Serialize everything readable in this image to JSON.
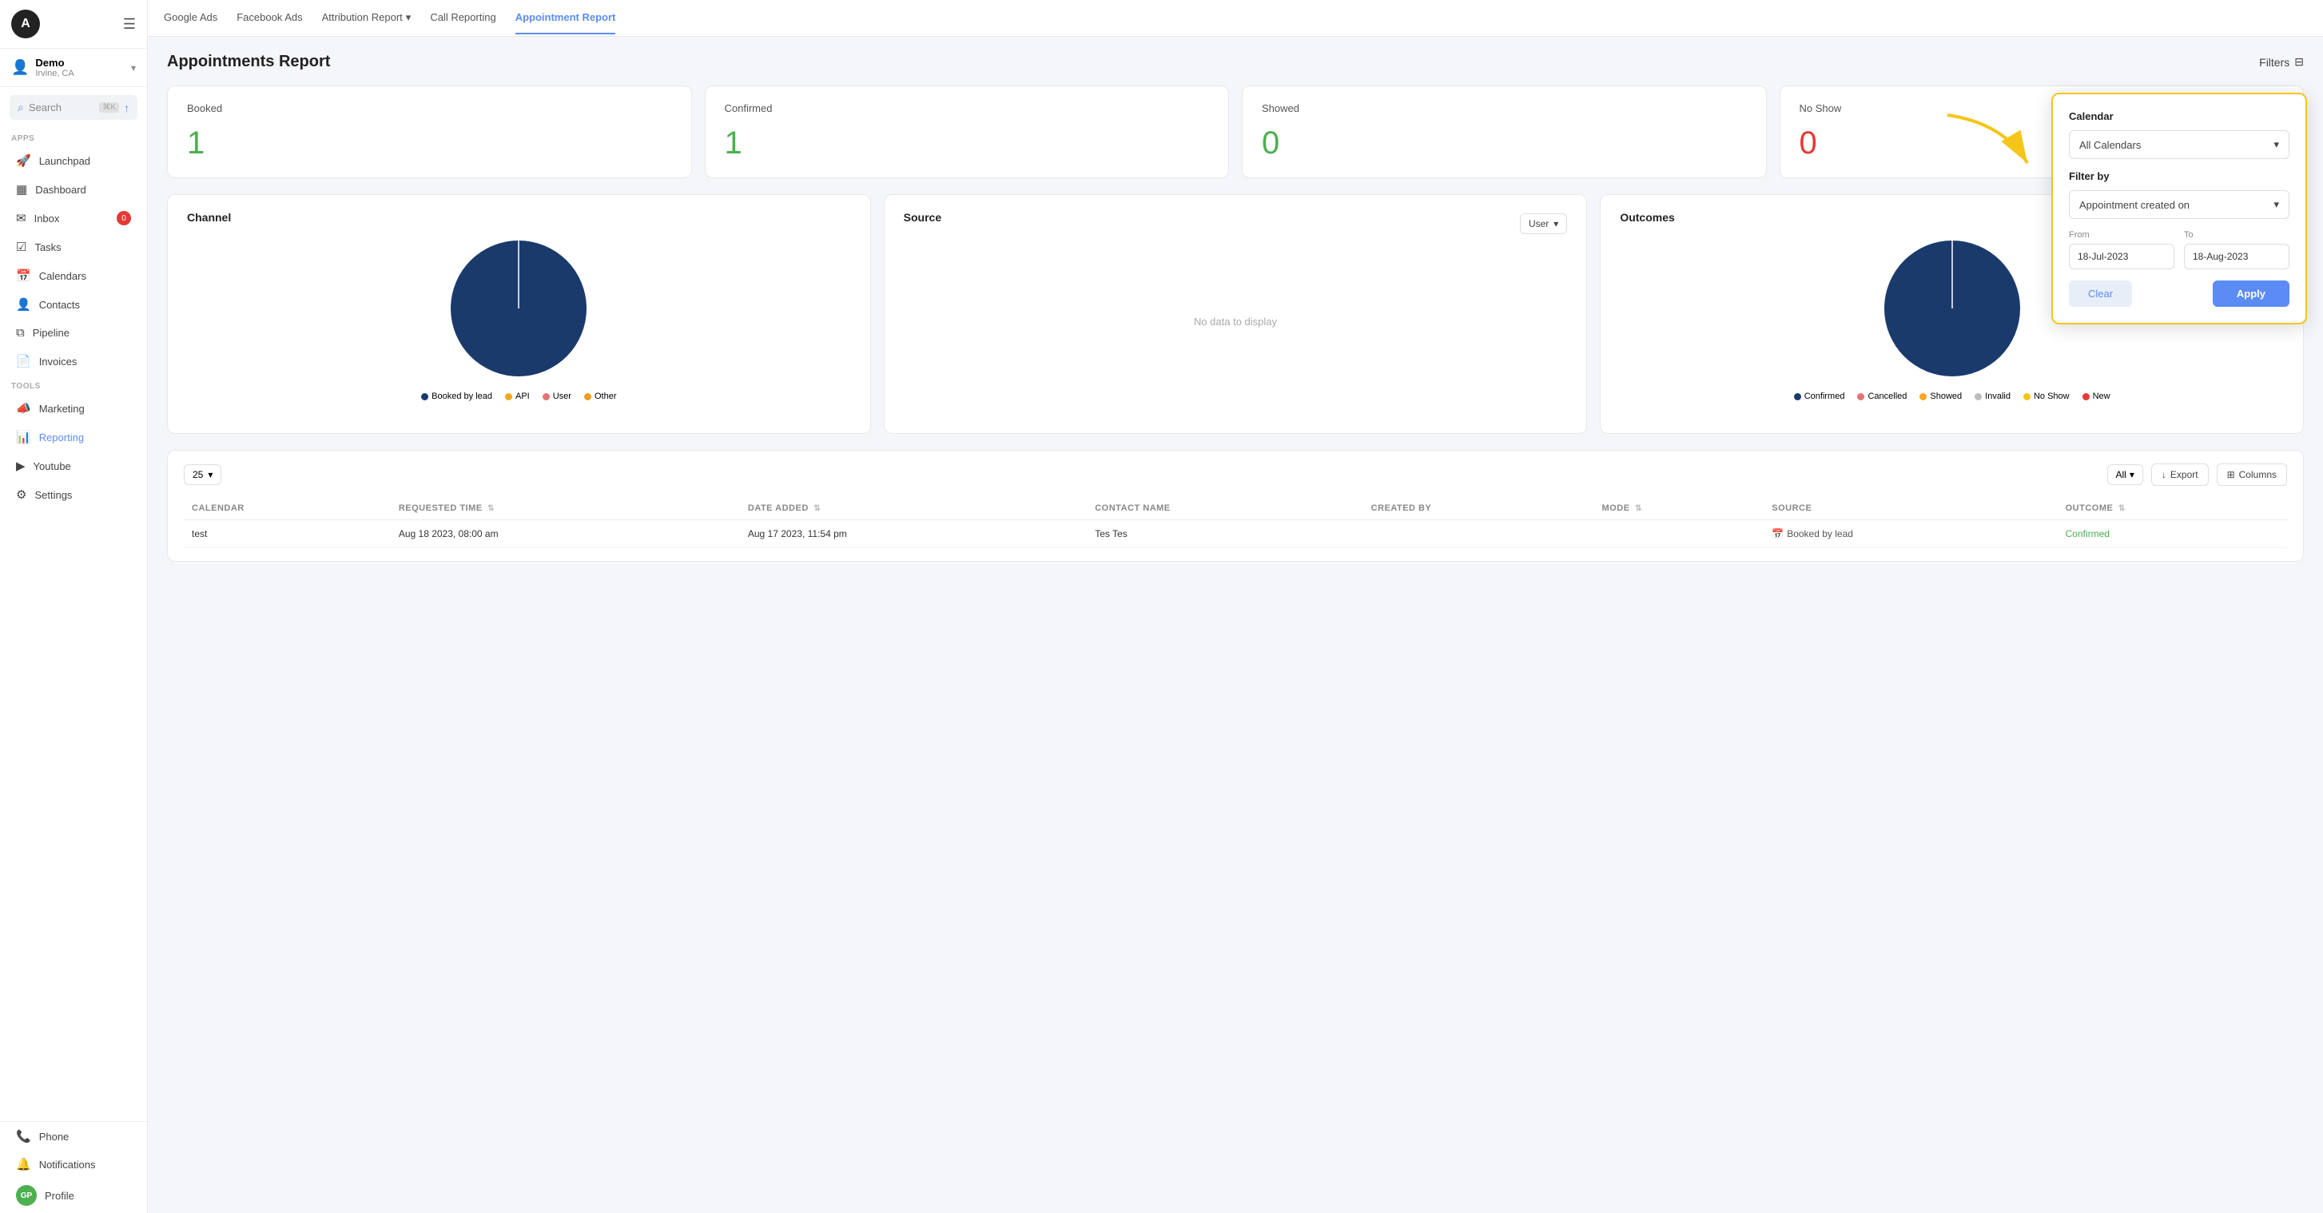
{
  "sidebar": {
    "logo_letter": "A",
    "account": {
      "name": "Demo",
      "location": "Irvine, CA"
    },
    "search": {
      "label": "Search",
      "shortcut": "⌘K"
    },
    "apps_label": "Apps",
    "apps": [
      {
        "id": "launchpad",
        "label": "Launchpad",
        "icon": "🚀"
      },
      {
        "id": "dashboard",
        "label": "Dashboard",
        "icon": "▦"
      },
      {
        "id": "inbox",
        "label": "Inbox",
        "icon": "✉",
        "badge": "0"
      },
      {
        "id": "tasks",
        "label": "Tasks",
        "icon": "☑"
      },
      {
        "id": "calendars",
        "label": "Calendars",
        "icon": "📅"
      },
      {
        "id": "contacts",
        "label": "Contacts",
        "icon": "👤"
      },
      {
        "id": "pipeline",
        "label": "Pipeline",
        "icon": "⧉"
      },
      {
        "id": "invoices",
        "label": "Invoices",
        "icon": "📄"
      }
    ],
    "tools_label": "Tools",
    "tools": [
      {
        "id": "marketing",
        "label": "Marketing",
        "icon": "📣"
      },
      {
        "id": "reporting",
        "label": "Reporting",
        "icon": "📊",
        "active": true
      },
      {
        "id": "youtube",
        "label": "Youtube",
        "icon": "▶"
      },
      {
        "id": "settings",
        "label": "Settings",
        "icon": "⚙"
      }
    ],
    "bottom": [
      {
        "id": "phone",
        "label": "Phone",
        "icon": "📞"
      },
      {
        "id": "notifications",
        "label": "Notifications",
        "icon": "🔔"
      },
      {
        "id": "profile",
        "label": "Profile",
        "icon": "GP",
        "avatar": true
      }
    ]
  },
  "topnav": {
    "items": [
      {
        "id": "google-ads",
        "label": "Google Ads",
        "active": false
      },
      {
        "id": "facebook-ads",
        "label": "Facebook Ads",
        "active": false
      },
      {
        "id": "attribution-report",
        "label": "Attribution Report",
        "active": false,
        "has_arrow": true
      },
      {
        "id": "call-reporting",
        "label": "Call Reporting",
        "active": false
      },
      {
        "id": "appointment-report",
        "label": "Appointment Report",
        "active": true
      }
    ]
  },
  "page": {
    "title": "Appointments Report",
    "filters_label": "Filters"
  },
  "stats": [
    {
      "id": "booked",
      "label": "Booked",
      "value": "1",
      "color": "green"
    },
    {
      "id": "confirmed",
      "label": "Confirmed",
      "value": "1",
      "color": "green"
    },
    {
      "id": "showed",
      "label": "Showed",
      "value": "0",
      "color": "green"
    },
    {
      "id": "no-show",
      "label": "No Show",
      "value": "0",
      "color": "red"
    }
  ],
  "charts": {
    "channel": {
      "title": "Channel",
      "legend": [
        {
          "label": "Booked by lead",
          "color": "#1a3a6b"
        },
        {
          "label": "API",
          "color": "#f5a623"
        },
        {
          "label": "User",
          "color": "#e57373"
        },
        {
          "label": "Other",
          "color": "#e8a020"
        }
      ]
    },
    "source": {
      "title": "Source",
      "user_label": "User",
      "no_data": "No data to display"
    },
    "outcomes": {
      "title": "Outcomes",
      "legend": [
        {
          "label": "Confirmed",
          "color": "#1a3a6b"
        },
        {
          "label": "Cancelled",
          "color": "#e57373"
        },
        {
          "label": "Showed",
          "color": "#f5a623"
        },
        {
          "label": "Invalid",
          "color": "#bdbdbd"
        },
        {
          "label": "No Show",
          "color": "#f5c518"
        },
        {
          "label": "New",
          "color": "#e53935"
        }
      ]
    }
  },
  "table": {
    "page_size": "25",
    "all_label": "All",
    "export_label": "Export",
    "columns_label": "Columns",
    "headers": [
      {
        "id": "calendar",
        "label": "CALENDAR"
      },
      {
        "id": "requested-time",
        "label": "REQUESTED TIME"
      },
      {
        "id": "date-added",
        "label": "DATE ADDED"
      },
      {
        "id": "contact-name",
        "label": "CONTACT NAME"
      },
      {
        "id": "created-by",
        "label": "CREATED BY"
      },
      {
        "id": "mode",
        "label": "MODE"
      },
      {
        "id": "source",
        "label": "SOURCE"
      },
      {
        "id": "outcome",
        "label": "OUTCOME"
      }
    ],
    "rows": [
      {
        "calendar": "test",
        "requested_time": "Aug 18 2023, 08:00 am",
        "date_added": "Aug 17 2023, 11:54 pm",
        "contact_name": "Tes Tes",
        "created_by": "",
        "mode": "",
        "source": "Booked by lead",
        "outcome": "Confirmed"
      }
    ]
  },
  "filter_panel": {
    "title": "Calendar",
    "calendar_value": "All Calendars",
    "filter_by_label": "Filter by",
    "filter_by_value": "Appointment created on",
    "from_label": "From",
    "to_label": "To",
    "from_value": "18-Jul-2023",
    "to_value": "18-Aug-2023",
    "clear_label": "Clear",
    "apply_label": "Apply"
  }
}
